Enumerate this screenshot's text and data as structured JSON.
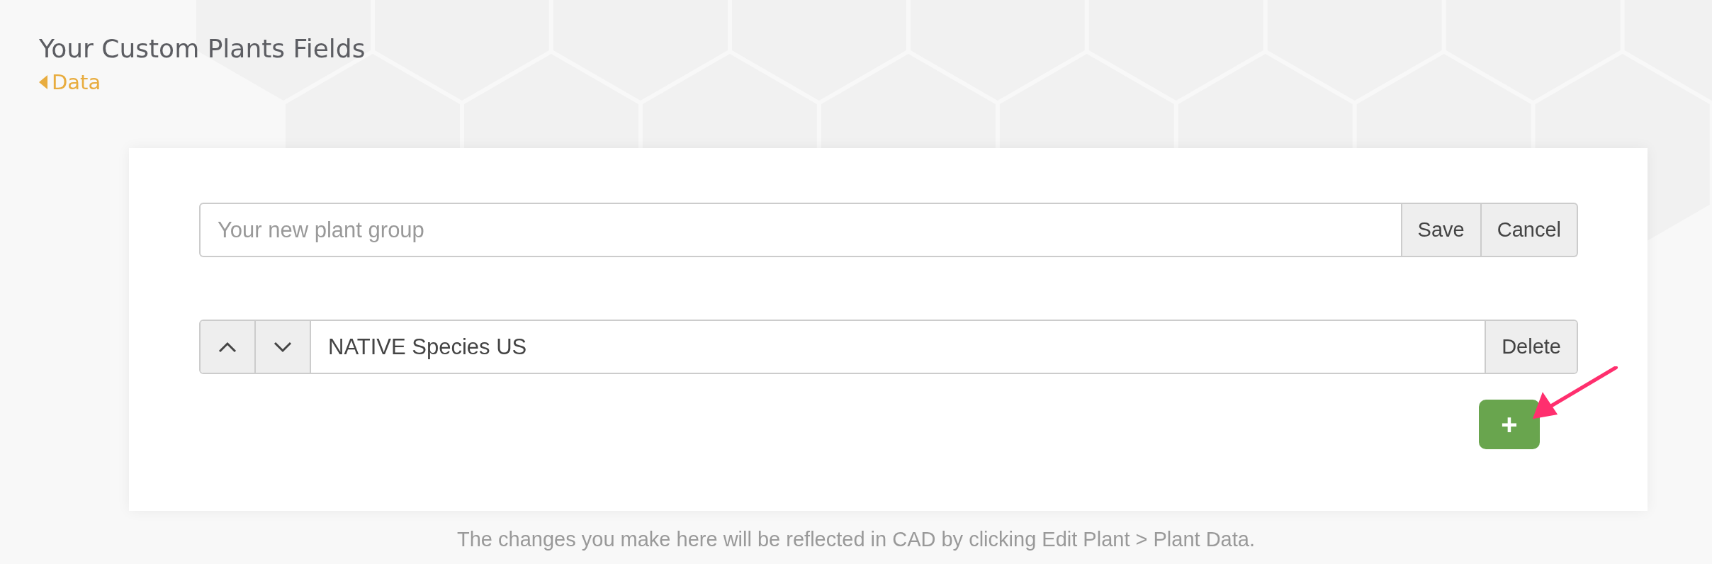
{
  "page": {
    "title": "Your Custom Plants Fields",
    "back_link": "Data"
  },
  "new_group": {
    "placeholder": "Your new plant group",
    "buttons": [
      "Save",
      "Cancel"
    ]
  },
  "groups": [
    {
      "name": "NATIVE Species US",
      "delete_label": "Delete"
    }
  ],
  "add_button": {
    "label": "+"
  },
  "footer_note": "The changes you make here will be reflected in CAD by clicking Edit Plant > Plant Data."
}
